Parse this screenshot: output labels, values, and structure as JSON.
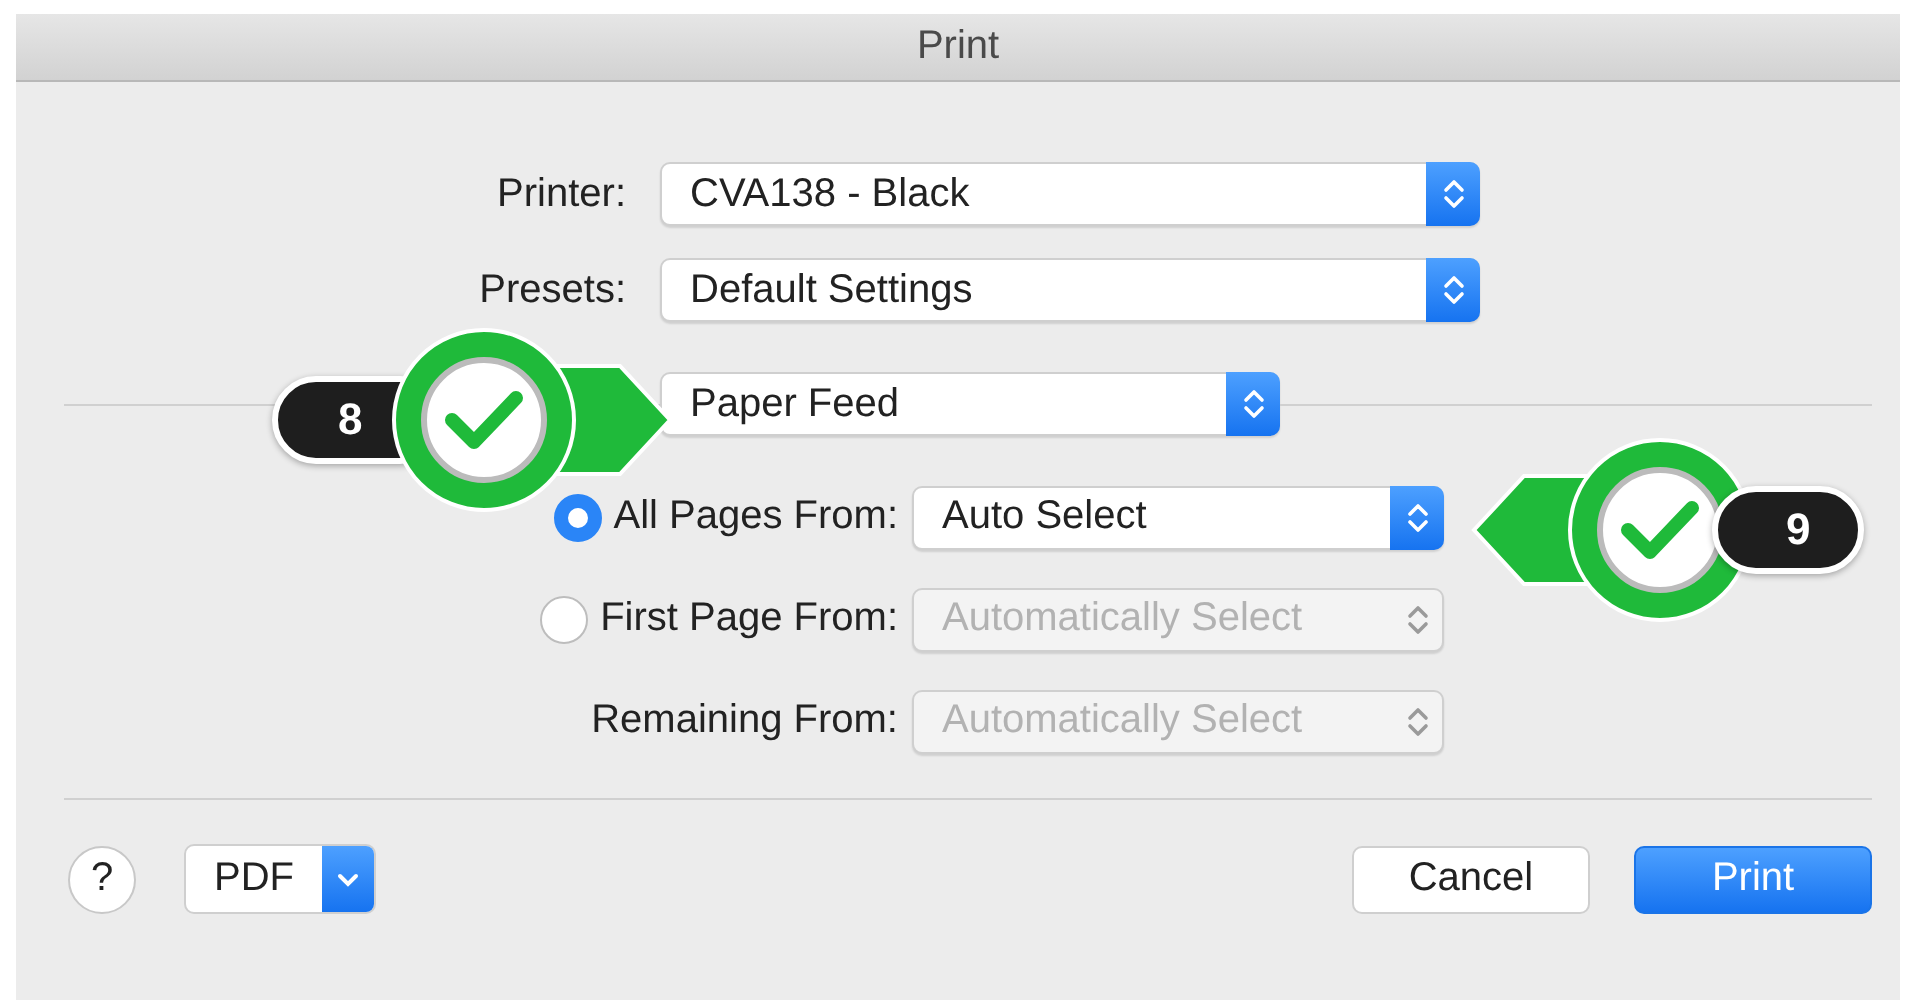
{
  "window": {
    "title": "Print"
  },
  "printer": {
    "label": "Printer:",
    "value": "CVA138 - Black"
  },
  "presets": {
    "label": "Presets:",
    "value": "Default Settings"
  },
  "panel_menu": {
    "value": "Paper Feed"
  },
  "sources": [
    {
      "label": "All Pages From:",
      "kind": "radio",
      "selected": true,
      "value": "Auto Select",
      "disabled": false
    },
    {
      "label": "First Page From:",
      "kind": "radio",
      "selected": false,
      "value": "Automatically Select",
      "disabled": true
    },
    {
      "label": "Remaining From:",
      "kind": "plain",
      "value": "Automatically Select",
      "disabled": true
    }
  ],
  "footer": {
    "help": "?",
    "pdf": "PDF",
    "cancel": "Cancel",
    "print": "Print"
  },
  "callouts": [
    {
      "number": "8",
      "kind": "rightward"
    },
    {
      "number": "9",
      "kind": "leftward"
    }
  ]
}
